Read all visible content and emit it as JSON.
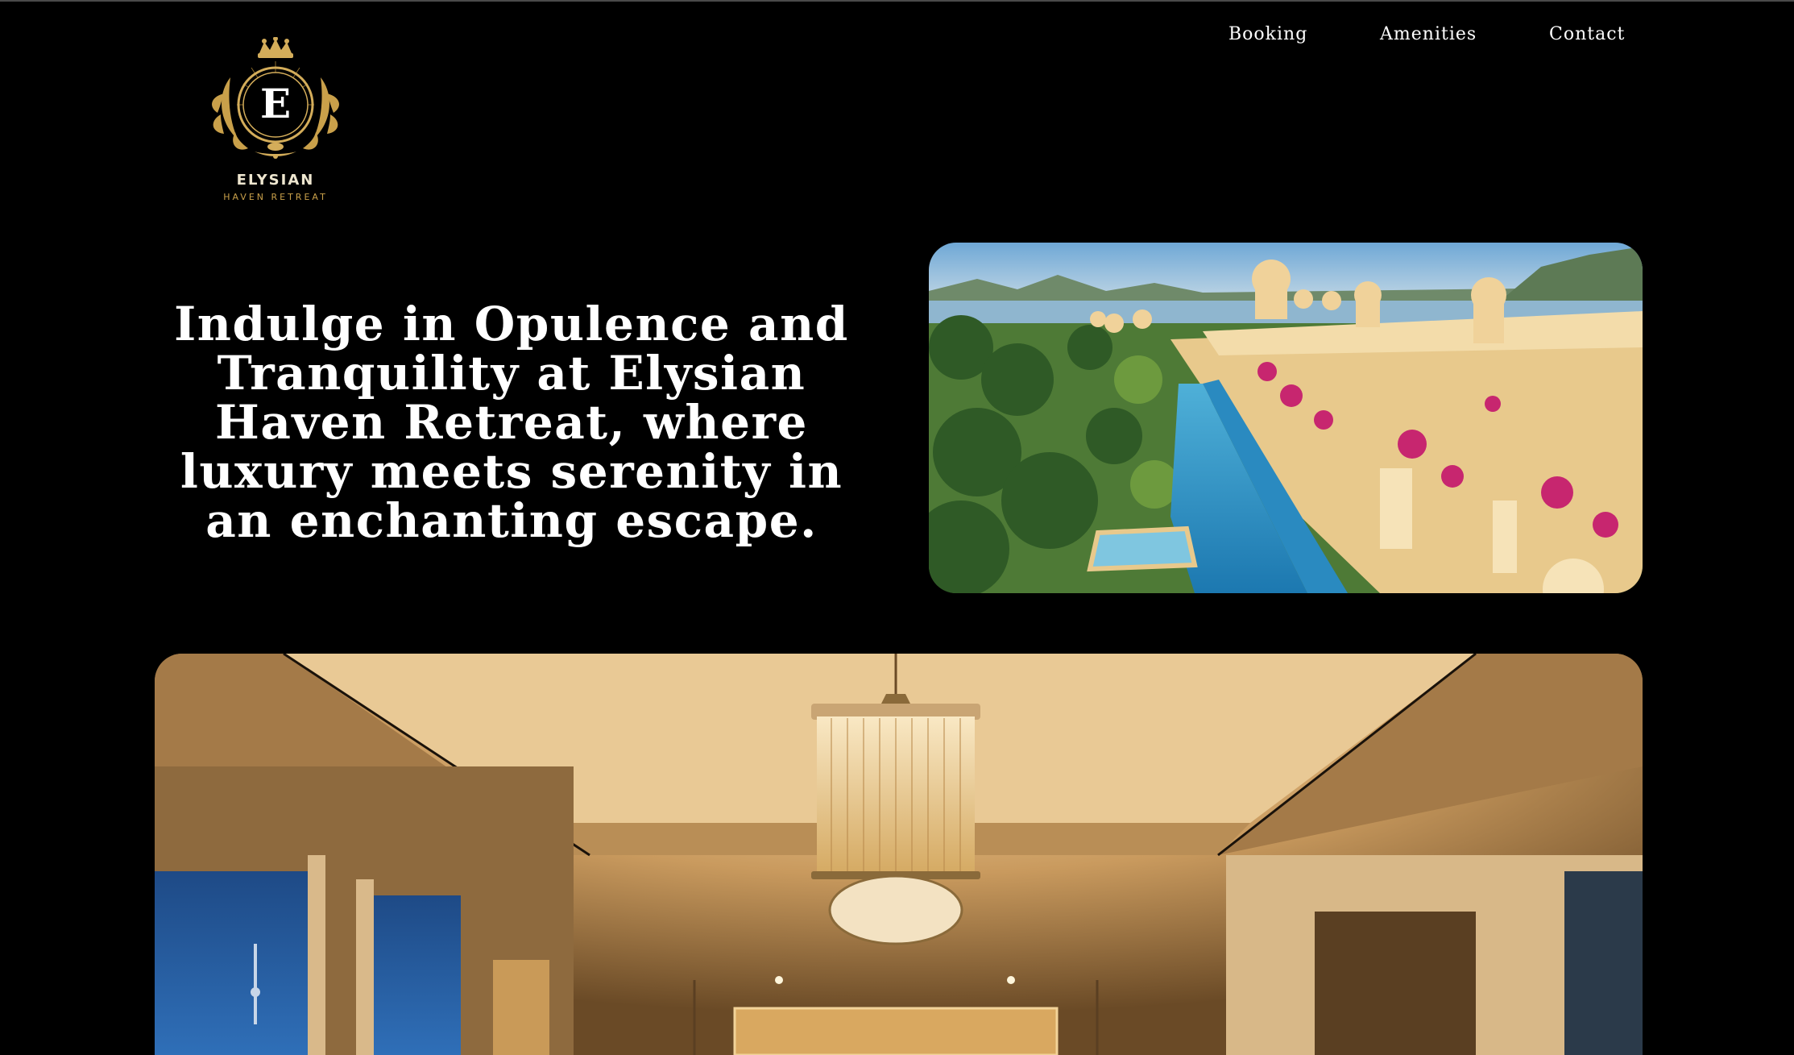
{
  "nav": {
    "items": [
      "Booking",
      "Amenities",
      "Contact"
    ]
  },
  "logo": {
    "letter": "E",
    "name": "ELYSIAN",
    "subtitle": "HAVEN RETREAT",
    "icon": "crest-icon"
  },
  "hero": {
    "headline": "Indulge in Opulence and Tranquility at Elysian Haven Retreat, where luxury meets serenity in an enchanting escape.",
    "image": "palace-pool-image"
  },
  "gallery": {
    "image": "hotel-room-image"
  },
  "colors": {
    "background": "#000000",
    "gold": "#c9a04a",
    "text": "#ffffff"
  }
}
